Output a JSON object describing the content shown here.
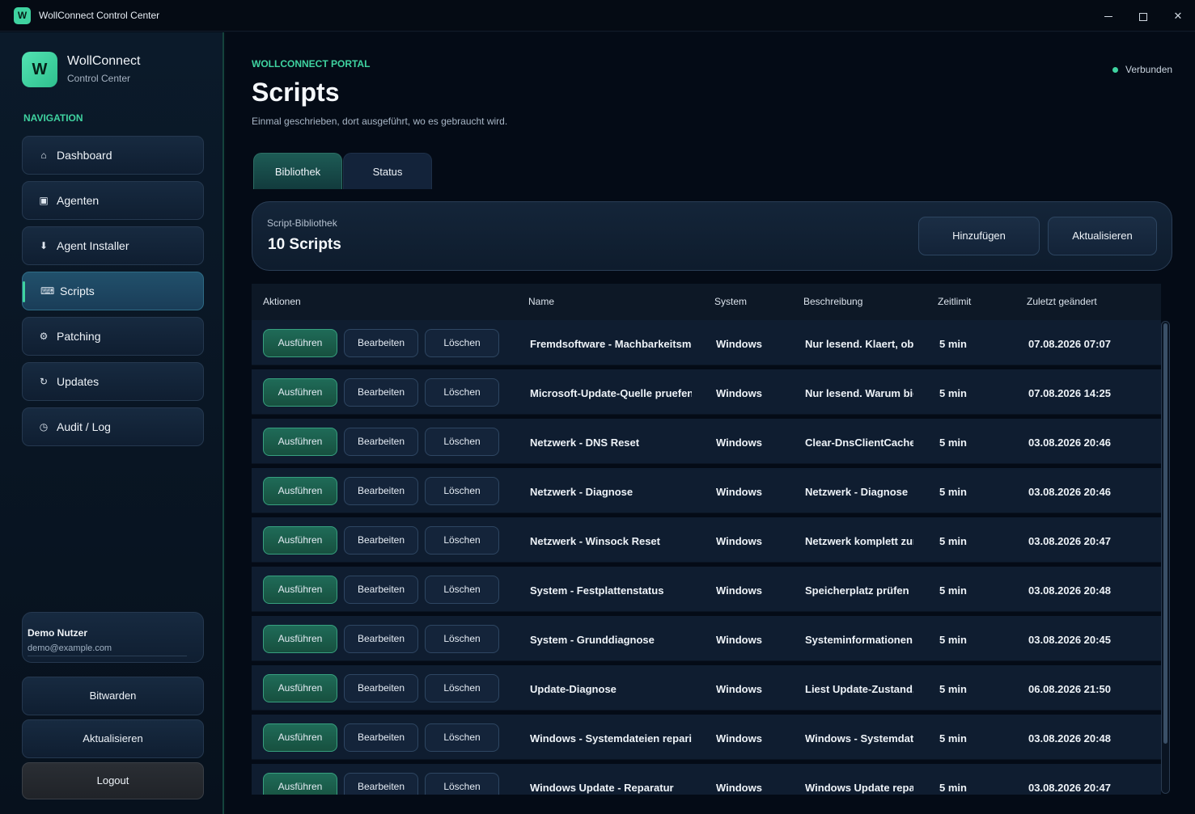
{
  "window": {
    "app_icon_letter": "W",
    "title": "WollConnect Control Center"
  },
  "brand": {
    "logo_letter": "W",
    "name": "WollConnect",
    "subtitle": "Control Center"
  },
  "nav": {
    "heading": "NAVIGATION",
    "items": [
      {
        "label": "Dashboard",
        "icon": "home-icon",
        "glyph": "⌂"
      },
      {
        "label": "Agenten",
        "icon": "monitor-icon",
        "glyph": "▣"
      },
      {
        "label": "Agent Installer",
        "icon": "download-icon",
        "glyph": "⬇"
      },
      {
        "label": "Scripts",
        "icon": "keyboard-icon",
        "glyph": "⌨",
        "active": true
      },
      {
        "label": "Patching",
        "icon": "gear-icon",
        "glyph": "⚙"
      },
      {
        "label": "Updates",
        "icon": "refresh-icon",
        "glyph": "↻"
      },
      {
        "label": "Audit / Log",
        "icon": "clock-icon",
        "glyph": "◷"
      }
    ]
  },
  "user": {
    "name": "Demo Nutzer",
    "email": "demo@example.com"
  },
  "sidebar_buttons": {
    "bitwarden": "Bitwarden",
    "refresh": "Aktualisieren",
    "logout": "Logout"
  },
  "header": {
    "eyebrow": "WOLLCONNECT PORTAL",
    "title": "Scripts",
    "subtitle": "Einmal geschrieben, dort ausgeführt, wo es gebraucht wird.",
    "connection": "Verbunden",
    "connection_color": "#3fd3a0"
  },
  "tabs": [
    {
      "label": "Bibliothek",
      "active": true
    },
    {
      "label": "Status"
    }
  ],
  "library": {
    "label": "Script-Bibliothek",
    "count": "10 Scripts",
    "add_label": "Hinzufügen",
    "refresh_label": "Aktualisieren"
  },
  "table": {
    "columns": [
      "Aktionen",
      "Name",
      "System",
      "Beschreibung",
      "Zeitlimit",
      "Zuletzt geändert"
    ],
    "action_labels": {
      "run": "Ausführen",
      "edit": "Bearbeiten",
      "delete": "Löschen"
    },
    "rows": [
      {
        "name": "Fremdsoftware - Machbarkeitsme",
        "system": "Windows",
        "description": "Nur lesend. Klaert, ob w",
        "timeout": "5 min",
        "modified": "07.08.2026 07:07"
      },
      {
        "name": "Microsoft-Update-Quelle pruefen",
        "system": "Windows",
        "description": "Nur lesend. Warum bie",
        "timeout": "5 min",
        "modified": "07.08.2026 14:25"
      },
      {
        "name": "Netzwerk - DNS Reset",
        "system": "Windows",
        "description": "Clear-DnsClientCache",
        "timeout": "5 min",
        "modified": "03.08.2026 20:46"
      },
      {
        "name": "Netzwerk - Diagnose",
        "system": "Windows",
        "description": "Netzwerk - Diagnose",
        "timeout": "5 min",
        "modified": "03.08.2026 20:46"
      },
      {
        "name": "Netzwerk - Winsock Reset",
        "system": "Windows",
        "description": "Netzwerk komplett zur",
        "timeout": "5 min",
        "modified": "03.08.2026 20:47"
      },
      {
        "name": "System - Festplattenstatus",
        "system": "Windows",
        "description": "Speicherplatz prüfen",
        "timeout": "5 min",
        "modified": "03.08.2026 20:48"
      },
      {
        "name": "System - Grunddiagnose",
        "system": "Windows",
        "description": "Systeminformationen s",
        "timeout": "5 min",
        "modified": "03.08.2026 20:45"
      },
      {
        "name": "Update-Diagnose",
        "system": "Windows",
        "description": "Liest Update-Zustand, '",
        "timeout": "5 min",
        "modified": "06.08.2026 21:50"
      },
      {
        "name": "Windows - Systemdateien reparie",
        "system": "Windows",
        "description": "Windows - Systemdate",
        "timeout": "5 min",
        "modified": "03.08.2026 20:48"
      },
      {
        "name": "Windows Update - Reparatur",
        "system": "Windows",
        "description": "Windows Update repar",
        "timeout": "5 min",
        "modified": "03.08.2026 20:47"
      }
    ]
  }
}
